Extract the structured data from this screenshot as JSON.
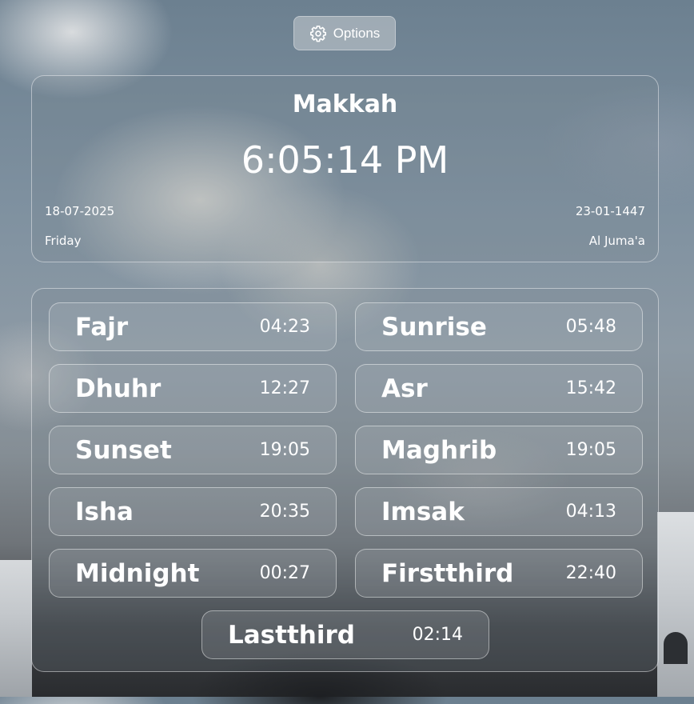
{
  "options": {
    "label": "Options",
    "icon": "gear-icon"
  },
  "clock": {
    "city": "Makkah",
    "time": "6:05:14 PM",
    "gregorian_date": "18-07-2025",
    "hijri_date": "23-01-1447",
    "weekday": "Friday",
    "hijri_weekday": "Al Juma'a"
  },
  "prayers": [
    {
      "name": "Fajr",
      "time": "04:23"
    },
    {
      "name": "Sunrise",
      "time": "05:48"
    },
    {
      "name": "Dhuhr",
      "time": "12:27"
    },
    {
      "name": "Asr",
      "time": "15:42"
    },
    {
      "name": "Sunset",
      "time": "19:05"
    },
    {
      "name": "Maghrib",
      "time": "19:05"
    },
    {
      "name": "Isha",
      "time": "20:35"
    },
    {
      "name": "Imsak",
      "time": "04:13"
    },
    {
      "name": "Midnight",
      "time": "00:27"
    },
    {
      "name": "Firstthird",
      "time": "22:40"
    },
    {
      "name": "Lastthird",
      "time": "02:14"
    }
  ]
}
